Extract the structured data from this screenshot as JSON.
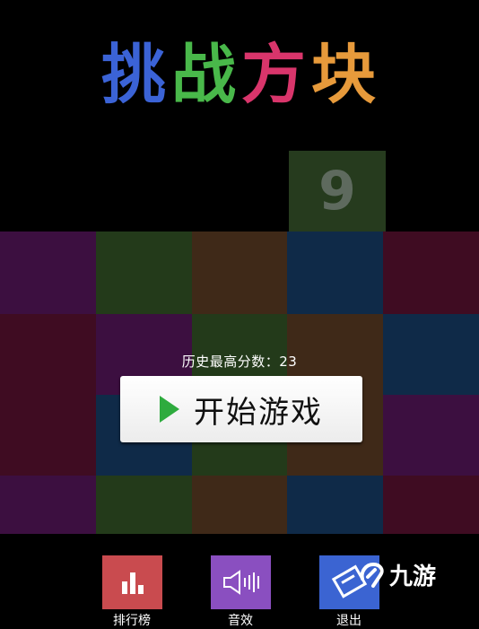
{
  "title": {
    "chars": [
      {
        "text": "挑",
        "color": "#3b63d6"
      },
      {
        "text": "战",
        "color": "#49b84a"
      },
      {
        "text": "方",
        "color": "#d9356b"
      },
      {
        "text": "块",
        "color": "#e79a3b"
      }
    ]
  },
  "top_block": {
    "number": "9",
    "color": "#263b1e"
  },
  "grid": {
    "rows": [
      [
        "#3c0f40",
        "#233a1a",
        "#3f2918",
        "#0f2a48",
        "#3f0c22"
      ],
      [
        "#3f0c22",
        "#3c0f40",
        "#233a1a",
        "#3f2918",
        "#0f2a48"
      ],
      [
        "#3f0c22",
        "#0f2a48",
        "#233a1a",
        "#3f2918",
        "#3c0f40"
      ],
      [
        "#3c0f40",
        "#233a1a",
        "#3f2918",
        "#0f2a48",
        "#3f0c22"
      ]
    ]
  },
  "best_score": {
    "label": "历史最高分数：23"
  },
  "start_button": {
    "label": "开始游戏",
    "icon": "play-icon"
  },
  "bottom_buttons": [
    {
      "name": "leaderboard",
      "label": "排行榜",
      "color": "#c94b4f",
      "icon": "bar-chart-icon"
    },
    {
      "name": "sound",
      "label": "音效",
      "color": "#8a4fc0",
      "icon": "speaker-icon"
    },
    {
      "name": "quit",
      "label": "退出",
      "color": "#3b64d2",
      "icon": "exit-icon"
    }
  ],
  "watermark": {
    "text": "九游"
  }
}
